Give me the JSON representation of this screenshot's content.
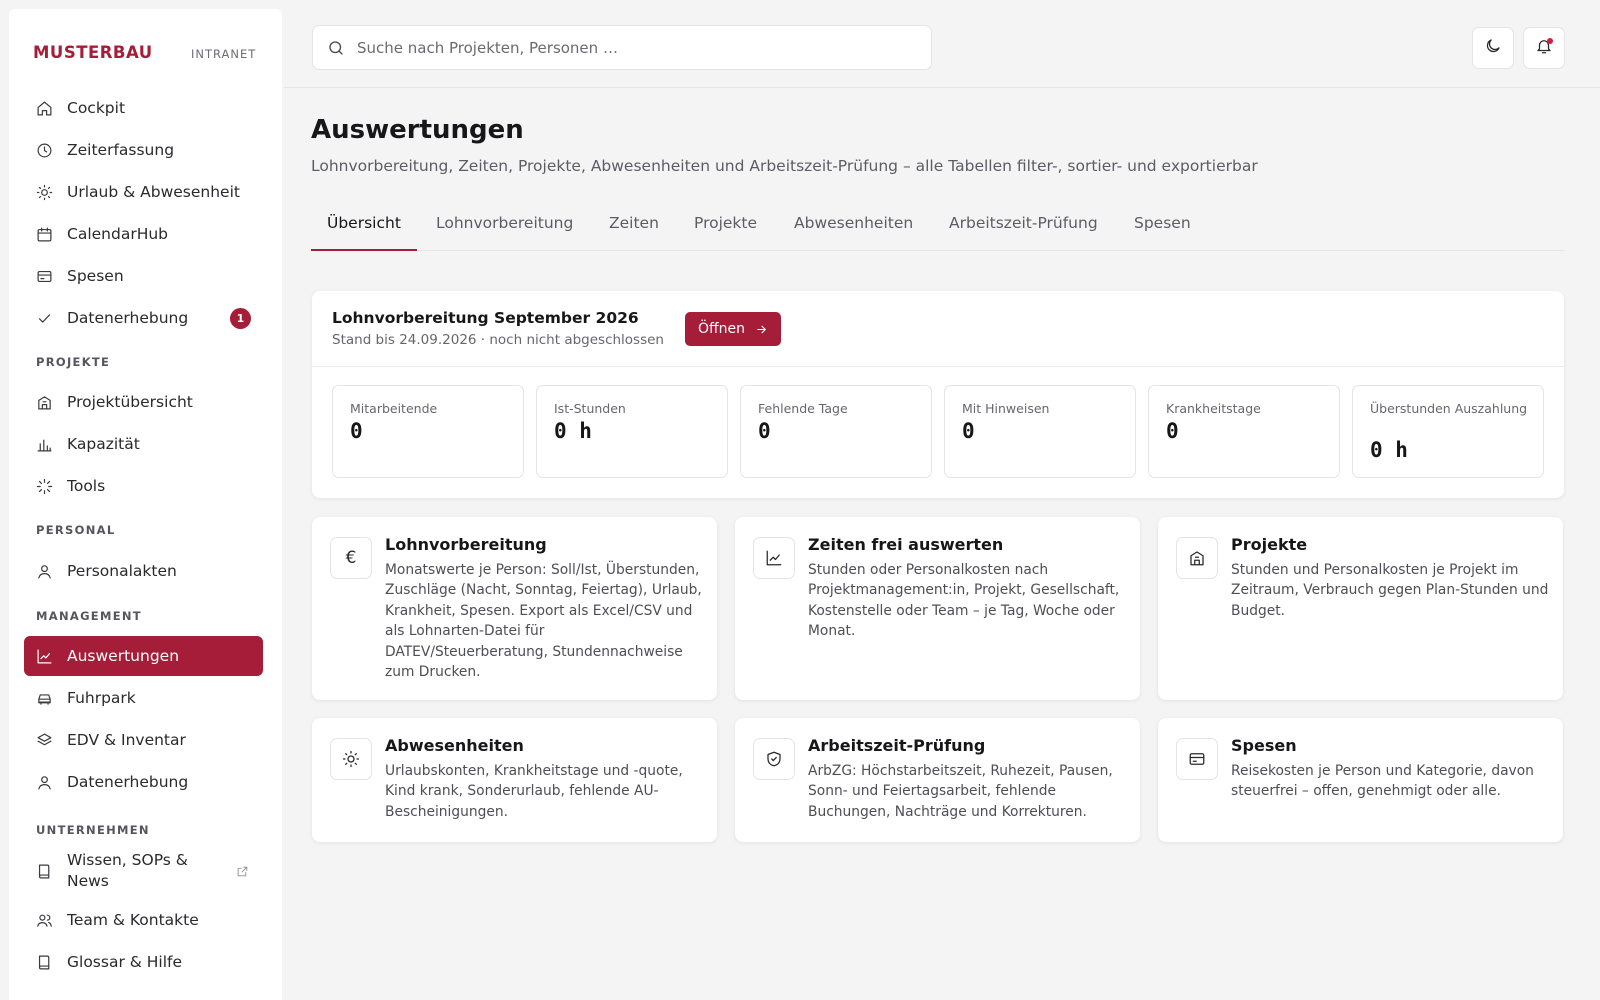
{
  "brand": {
    "name": "MUSTERBAU",
    "tag": "INTRANET",
    "accent": "#a51d38"
  },
  "sidebar": {
    "items_top": [
      {
        "label": "Cockpit",
        "icon": "home-icon"
      },
      {
        "label": "Zeiterfassung",
        "icon": "clock-icon"
      },
      {
        "label": "Urlaub & Abwesenheit",
        "icon": "sun-icon"
      },
      {
        "label": "CalendarHub",
        "icon": "calendar-icon"
      },
      {
        "label": "Spesen",
        "icon": "card-icon"
      },
      {
        "label": "Datenerhebung",
        "icon": "check-icon",
        "badge": "1"
      }
    ],
    "sections": {
      "projekte": {
        "label": "PROJEKTE",
        "items": [
          {
            "label": "Projektübersicht",
            "icon": "building-icon"
          },
          {
            "label": "Kapazität",
            "icon": "bar-chart-icon"
          },
          {
            "label": "Tools",
            "icon": "loader-icon"
          }
        ]
      },
      "personal": {
        "label": "PERSONAL",
        "items": [
          {
            "label": "Personalakten",
            "icon": "user-icon"
          }
        ]
      },
      "management": {
        "label": "MANAGEMENT",
        "items": [
          {
            "label": "Auswertungen",
            "icon": "line-chart-icon",
            "active": true
          },
          {
            "label": "Fuhrpark",
            "icon": "car-icon"
          },
          {
            "label": "EDV & Inventar",
            "icon": "layers-icon"
          },
          {
            "label": "Datenerhebung",
            "icon": "user-icon"
          }
        ]
      },
      "unternehmen": {
        "label": "UNTERNEHMEN",
        "items": [
          {
            "label": "Wissen, SOPs & News",
            "line1": "Wissen, SOPs &",
            "line2": "News",
            "icon": "book-icon",
            "external": true
          },
          {
            "label": "Team & Kontakte",
            "icon": "users-icon"
          },
          {
            "label": "Glossar & Hilfe",
            "icon": "book-icon"
          }
        ]
      }
    }
  },
  "topbar": {
    "search_placeholder": "Suche nach Projekten, Personen …",
    "theme_icon": "moon-icon",
    "notifications_icon": "bell-icon"
  },
  "page": {
    "title": "Auswertungen",
    "subtitle": "Lohnvorbereitung, Zeiten, Projekte, Abwesenheiten und Arbeitszeit-Prüfung – alle Tabellen filter-, sortier- und exportierbar",
    "tabs": [
      "Übersicht",
      "Lohnvorbereitung",
      "Zeiten",
      "Projekte",
      "Abwesenheiten",
      "Arbeitszeit-Prüfung",
      "Spesen"
    ],
    "active_tab": "Übersicht"
  },
  "payroll": {
    "title": "Lohnvorbereitung September 2026",
    "status": "Stand bis 24.09.2026 · noch nicht abgeschlossen",
    "open_label": "Öffnen",
    "stats": [
      {
        "label": "Mitarbeitende",
        "value": "0"
      },
      {
        "label": "Ist-Stunden",
        "value": "0 h"
      },
      {
        "label": "Fehlende Tage",
        "value": "0"
      },
      {
        "label": "Mit Hinweisen",
        "value": "0"
      },
      {
        "label": "Krankheitstage",
        "value": "0"
      },
      {
        "label": "Überstunden Auszahlung",
        "value": "0 h"
      }
    ]
  },
  "modules": [
    {
      "title": "Lohnvorbereitung",
      "icon": "euro-icon",
      "desc": "Monatswerte je Person: Soll/Ist, Überstunden, Zuschläge (Nacht, Sonntag, Feiertag), Urlaub, Krankheit, Spesen. Export als Excel/CSV und als Lohnarten-Datei für DATEV/Steuerberatung, Stundennachweise zum Drucken."
    },
    {
      "title": "Zeiten frei auswerten",
      "icon": "line-chart-icon",
      "desc": "Stunden oder Personalkosten nach Projektmanagement:in, Projekt, Gesellschaft, Kostenstelle oder Team – je Tag, Woche oder Monat."
    },
    {
      "title": "Projekte",
      "icon": "building-icon",
      "desc": "Stunden und Personalkosten je Projekt im Zeitraum, Verbrauch gegen Plan-Stunden und Budget."
    },
    {
      "title": "Abwesenheiten",
      "icon": "sun-icon",
      "desc": "Urlaubskonten, Krankheitstage und -quote, Kind krank, Sonderurlaub, fehlende AU-Bescheinigungen."
    },
    {
      "title": "Arbeitszeit-Prüfung",
      "icon": "shield-check-icon",
      "desc": "ArbZG: Höchstarbeitszeit, Ruhezeit, Pausen, Sonn- und Feiertagsarbeit, fehlende Buchungen, Nachträge und Korrekturen."
    },
    {
      "title": "Spesen",
      "icon": "card-icon",
      "desc": "Reisekosten je Person und Kategorie, davon steuerfrei – offen, genehmigt oder alle."
    }
  ]
}
